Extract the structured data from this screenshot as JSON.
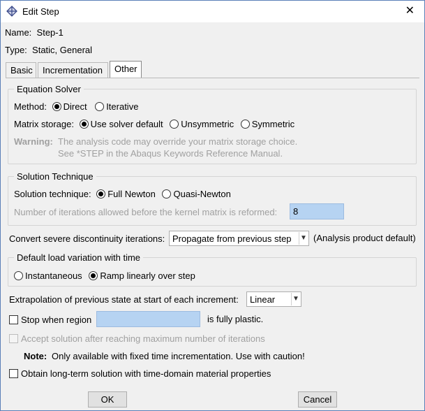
{
  "window": {
    "title": "Edit Step",
    "close_glyph": "✕"
  },
  "header": {
    "name_label": "Name:",
    "name_value": "Step-1",
    "type_label": "Type:",
    "type_value": "Static, General"
  },
  "tabs": [
    {
      "label": "Basic",
      "active": false
    },
    {
      "label": "Incrementation",
      "active": false
    },
    {
      "label": "Other",
      "active": true
    }
  ],
  "equation_solver": {
    "title": "Equation Solver",
    "method_label": "Method:",
    "method_options": [
      "Direct",
      "Iterative"
    ],
    "method_selected": "Direct",
    "matrix_label": "Matrix storage:",
    "matrix_options": [
      "Use solver default",
      "Unsymmetric",
      "Symmetric"
    ],
    "matrix_selected": "Use solver default",
    "warning_label": "Warning:",
    "warning_line1": "The analysis code may override your matrix storage choice.",
    "warning_line2": "See *STEP in the Abaqus Keywords Reference Manual."
  },
  "solution_technique": {
    "title": "Solution Technique",
    "label": "Solution technique:",
    "options": [
      "Full Newton",
      "Quasi-Newton"
    ],
    "selected": "Full Newton",
    "iterations_label": "Number of iterations allowed before the kernel matrix is reformed:",
    "iterations_value": "8"
  },
  "discontinuity": {
    "label": "Convert severe discontinuity iterations:",
    "selected": "Propagate from previous step",
    "note": "(Analysis product default)"
  },
  "load_variation": {
    "title": "Default load variation with time",
    "options": [
      "Instantaneous",
      "Ramp linearly over step"
    ],
    "selected": "Ramp linearly over step"
  },
  "extrapolation": {
    "label": "Extrapolation of previous state at start of each increment:",
    "selected": "Linear"
  },
  "stop_region": {
    "label": "Stop when region",
    "value": "",
    "suffix": "is fully plastic.",
    "checked": false
  },
  "accept_solution": {
    "label": "Accept solution after reaching maximum number of iterations",
    "checked": false,
    "enabled": false
  },
  "note": {
    "label": "Note:",
    "text": "Only available with fixed time incrementation. Use with caution!"
  },
  "long_term": {
    "label": "Obtain long-term solution with time-domain material properties",
    "checked": false
  },
  "buttons": {
    "ok": "OK",
    "cancel": "Cancel"
  }
}
